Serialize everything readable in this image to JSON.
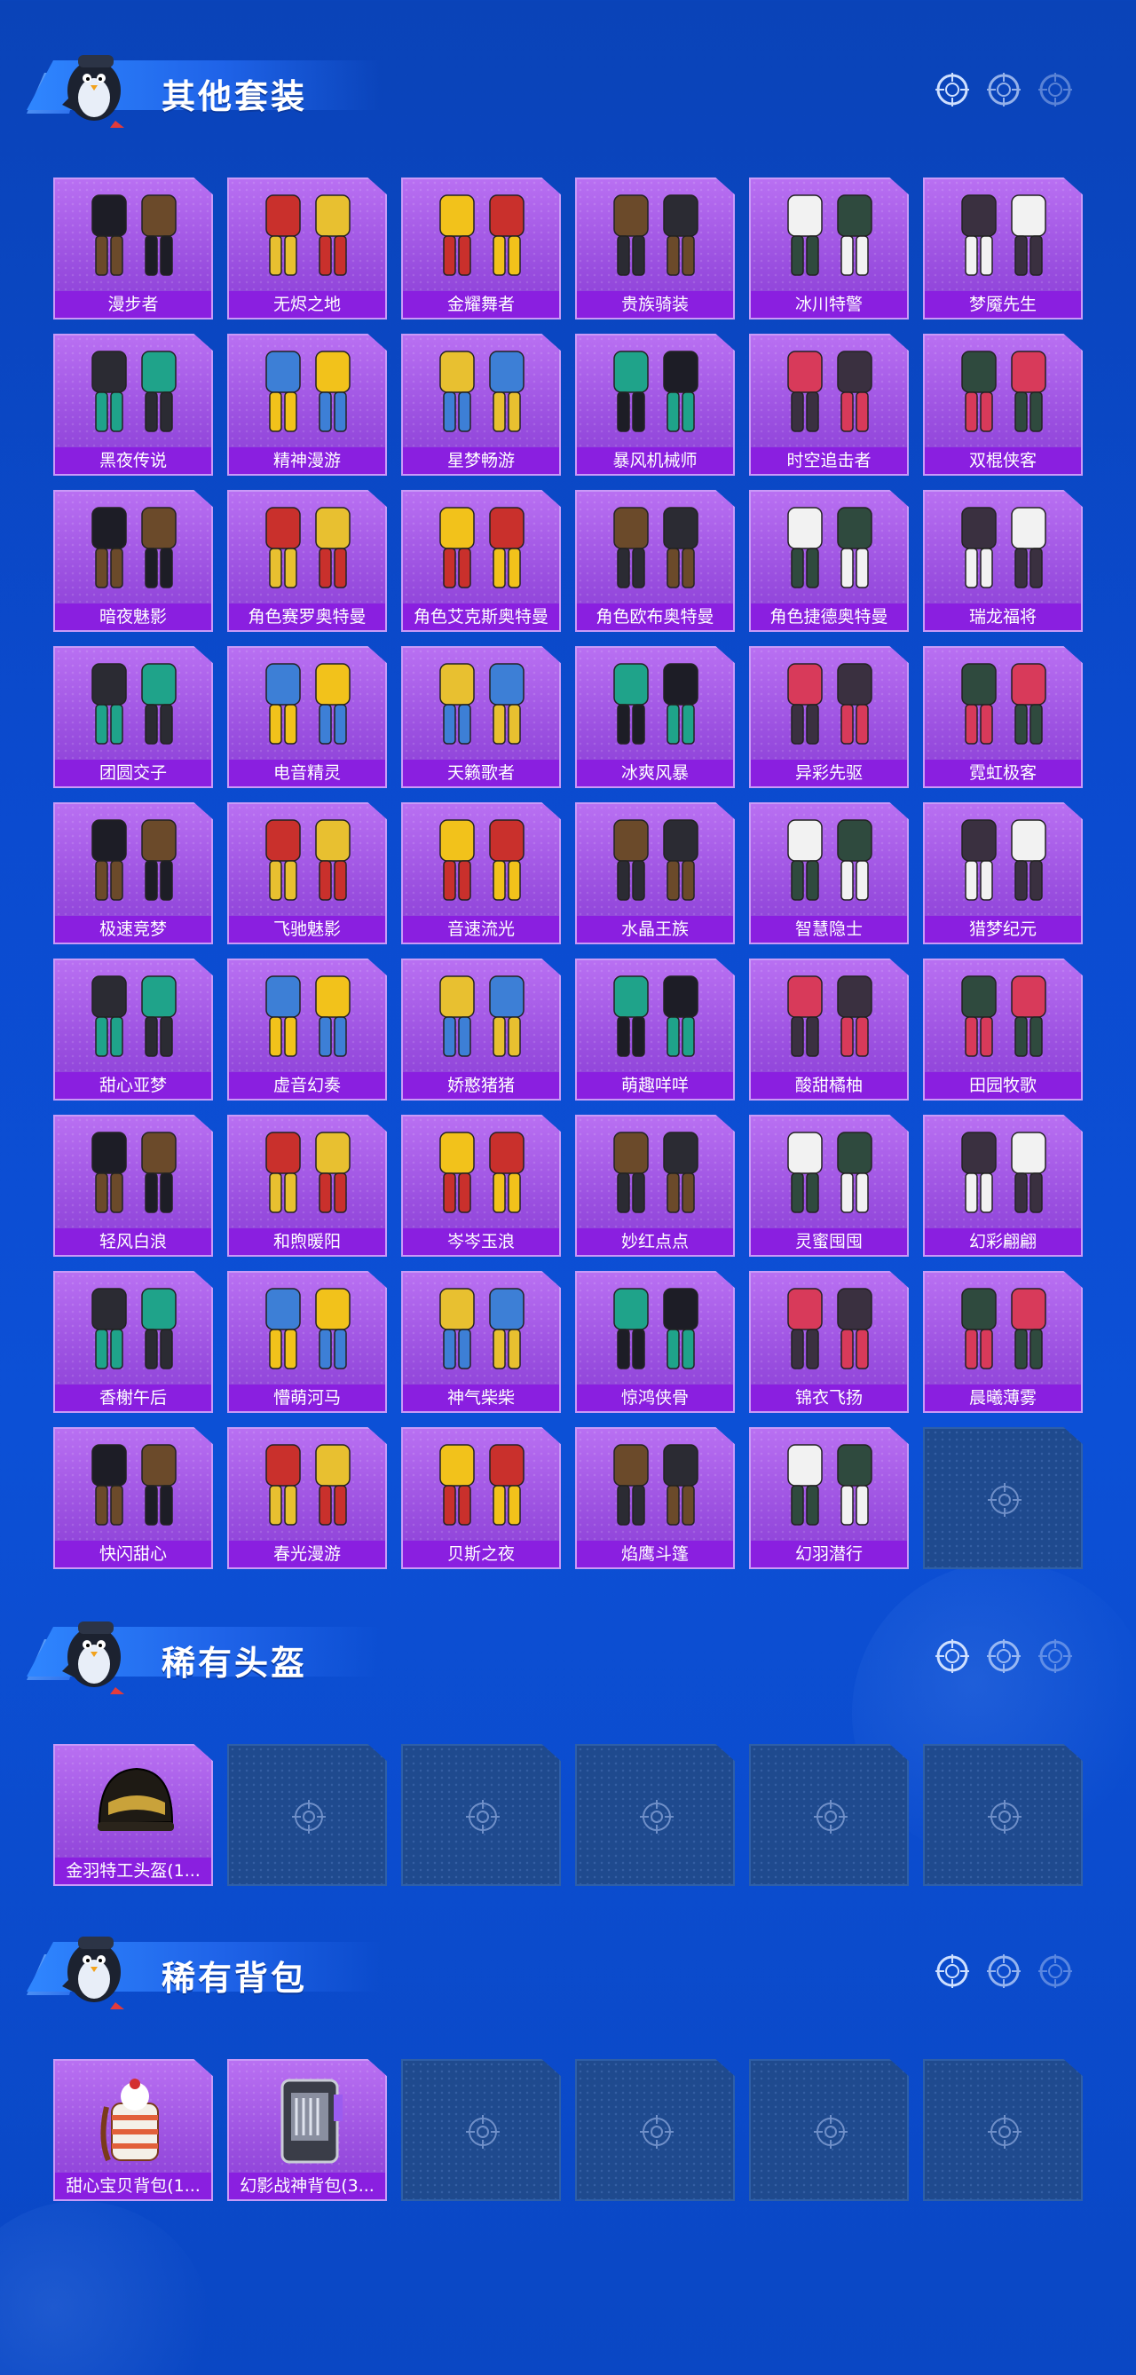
{
  "sections": {
    "outfits": {
      "title": "其他套装",
      "items": [
        "漫步者",
        "无烬之地",
        "金耀舞者",
        "贵族骑装",
        "冰川特警",
        "梦魇先生",
        "黑夜传说",
        "精神漫游",
        "星梦畅游",
        "暴风机械师",
        "时空追击者",
        "双棍侠客",
        "暗夜魅影",
        "角色赛罗奥特曼",
        "角色艾克斯奥特曼",
        "角色欧布奥特曼",
        "角色捷德奥特曼",
        "瑞龙福将",
        "团圆交子",
        "电音精灵",
        "天籁歌者",
        "冰爽风暴",
        "异彩先驱",
        "霓虹极客",
        "极速竞梦",
        "飞驰魅影",
        "音速流光",
        "水晶王族",
        "智慧隐士",
        "猎梦纪元",
        "甜心亚梦",
        "虚音幻奏",
        "娇憨猪猪",
        "萌趣咩咩",
        "酸甜橘柚",
        "田园牧歌",
        "轻风白浪",
        "和煦暖阳",
        "岑岑玉浪",
        "妙红点点",
        "灵蜜囤囤",
        "幻彩翩翩",
        "香榭午后",
        "懵萌河马",
        "神气柴柴",
        "惊鸿侠骨",
        "锦衣飞扬",
        "晨曦薄雾",
        "快闪甜心",
        "春光漫游",
        "贝斯之夜",
        "焰鹰斗篷",
        "幻羽潜行"
      ]
    },
    "helmets": {
      "title": "稀有头盔",
      "items": [
        "金羽特工头盔(1..."
      ]
    },
    "backpacks": {
      "title": "稀有背包",
      "items": [
        "甜心宝贝背包(1...",
        "幻影战神背包(3..."
      ]
    }
  },
  "icons": {
    "mascot": "penguin-mascot-icon",
    "empty_slot": "crosshair-target-icon",
    "header_decor": "crosshair-target-icon"
  },
  "colors": {
    "background": "#0b4bd0",
    "card_purple": "#9b50e0",
    "label_purple": "#8a1fe0",
    "empty_slot": "#1f4a8e"
  }
}
